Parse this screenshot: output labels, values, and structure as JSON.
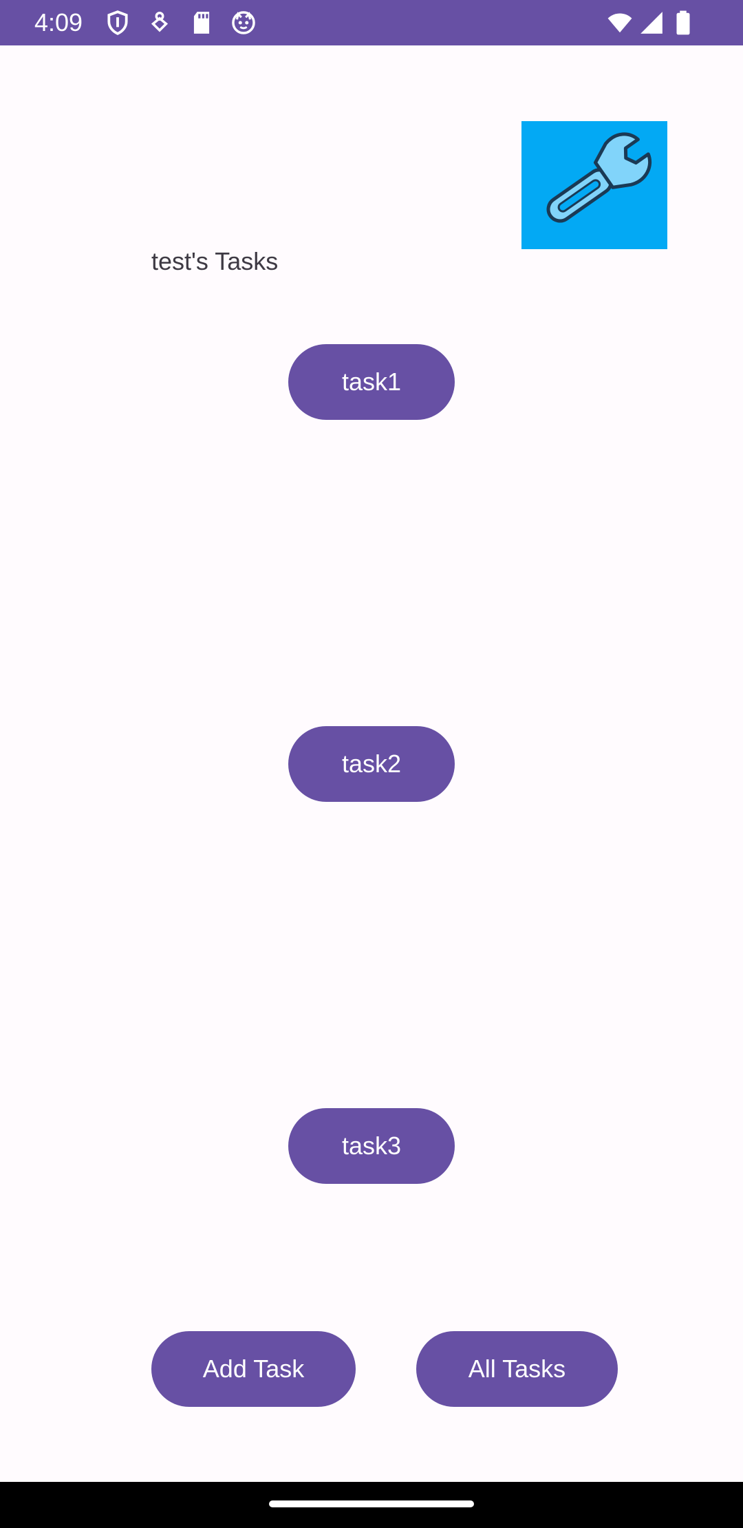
{
  "status_bar": {
    "time": "4:09",
    "left_icons": [
      "shield-icon",
      "location-pin-icon",
      "sd-card-icon",
      "cat-face-icon"
    ],
    "right_icons": [
      "wifi-icon",
      "cellular-signal-icon",
      "battery-icon"
    ],
    "background_color": "#6750A4"
  },
  "header": {
    "title": "test's Tasks",
    "settings_image_icon": "wrench-icon",
    "settings_image_bg": "#03A9F4"
  },
  "tasks": [
    {
      "label": "task1"
    },
    {
      "label": "task2"
    },
    {
      "label": "task3"
    }
  ],
  "actions": {
    "add_task_label": "Add Task",
    "all_tasks_label": "All Tasks"
  },
  "theme": {
    "primary": "#6750A4",
    "background": "#FFFBFE",
    "on_primary": "#FFFFFF"
  }
}
